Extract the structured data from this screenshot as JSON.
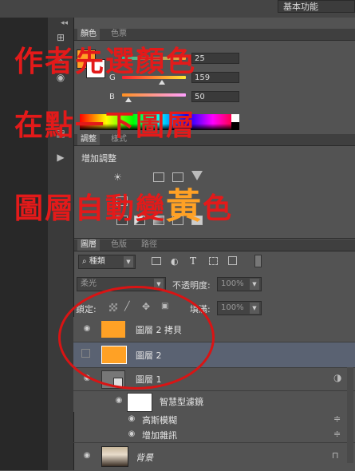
{
  "workspace": {
    "label": "基本功能"
  },
  "color_panel": {
    "tabs": [
      "顏色",
      "色票"
    ],
    "channels": [
      {
        "label": "",
        "value": "25"
      },
      {
        "label": "G",
        "value": "159"
      },
      {
        "label": "B",
        "value": "50"
      }
    ],
    "foreground": "#ffa125"
  },
  "adjust_panel": {
    "tabs": [
      "調整",
      "樣式"
    ],
    "heading": "增加調整"
  },
  "layers_panel": {
    "tabs": [
      "圖層",
      "色版",
      "路徑"
    ],
    "filter_kind": "種類",
    "blend_mode": "柔光",
    "opacity_label": "不透明度:",
    "opacity_value": "100%",
    "lock_label": "鎖定:",
    "fill_label": "填滿:",
    "fill_value": "100%",
    "layers": [
      {
        "name": "圖層 2 拷貝",
        "visible": true,
        "selected": false,
        "thumb": "#ffa125"
      },
      {
        "name": "圖層 2",
        "visible": false,
        "selected": true,
        "thumb": "#ffa125"
      },
      {
        "name": "圖層 1",
        "visible": true,
        "selected": false,
        "thumb": "#777777"
      }
    ],
    "smart_filter_label": "智慧型濾鏡",
    "filters": [
      "高斯模糊",
      "增加雜訊"
    ],
    "background_layer": "背景"
  },
  "annotations": {
    "line1": "作者先選顏色",
    "line2": "在點一下圖層",
    "line3_a": "圖層自動變",
    "line3_b": "黃",
    "line3_c": "色",
    "text_color": "#e31a1a",
    "highlight_color": "#ffa125"
  }
}
